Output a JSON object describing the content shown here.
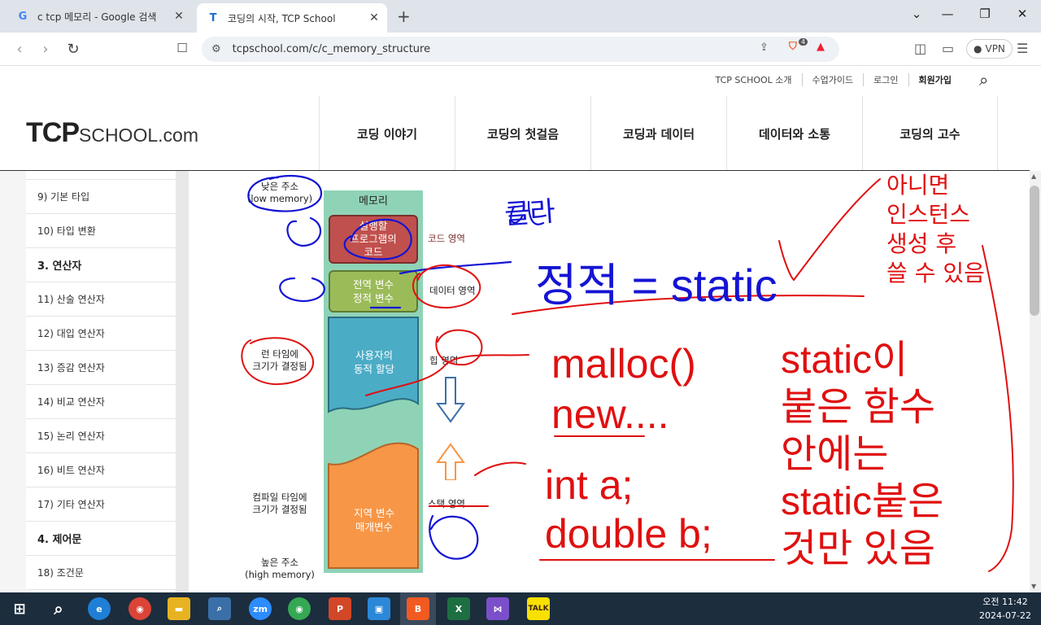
{
  "browser": {
    "tabs": [
      {
        "title": "c tcp 메모리 - Google 검색",
        "icon": "G"
      },
      {
        "title": "코딩의 시작, TCP School",
        "icon": "T"
      }
    ],
    "url": "tcpschool.com/c/c_memory_structure",
    "vpn_label": "VPN",
    "brave_badge": "4"
  },
  "site": {
    "top_menu": [
      "TCP SCHOOL 소개",
      "수업가이드",
      "로그인",
      "회원가입"
    ],
    "logo_main": "TCP",
    "logo_small": "SCHOOL.com",
    "main_nav": [
      "코딩 이야기",
      "코딩의 첫걸음",
      "코딩과 데이터",
      "데이터와 소통",
      "코딩의 고수"
    ]
  },
  "sidebar": {
    "items": [
      {
        "label": "",
        "head": false
      },
      {
        "label": "9) 기본 타입",
        "head": false
      },
      {
        "label": "10) 타입 변환",
        "head": false
      },
      {
        "label": "3. 연산자",
        "head": true
      },
      {
        "label": "11) 산술 연산자",
        "head": false
      },
      {
        "label": "12) 대입 연산자",
        "head": false
      },
      {
        "label": "13) 증감 연산자",
        "head": false
      },
      {
        "label": "14) 비교 연산자",
        "head": false
      },
      {
        "label": "15) 논리 연산자",
        "head": false
      },
      {
        "label": "16) 비트 연산자",
        "head": false
      },
      {
        "label": "17) 기타 연산자",
        "head": false
      },
      {
        "label": "4. 제어문",
        "head": true
      },
      {
        "label": "18) 조건문",
        "head": false
      }
    ]
  },
  "diagram": {
    "memory_title": "메모리",
    "low_addr": [
      "낮은 주소",
      "(low memory)"
    ],
    "high_addr": [
      "높은 주소",
      "(high memory)"
    ],
    "runtime_label": [
      "런 타임에",
      "크기가 결정됨"
    ],
    "compile_label": [
      "컴파일 타임에",
      "크기가 결정됨"
    ],
    "code_block": [
      "실행할",
      "프로그램의",
      "코드"
    ],
    "data_block": [
      "전역 변수",
      "정적 변수"
    ],
    "heap_block": [
      "사용자의",
      "동적 할당"
    ],
    "stack_block": [
      "지역 변수",
      "매개변수"
    ],
    "code_area": "코드 영역",
    "data_area": "데이터 영역",
    "heap_area": "힙 영역",
    "stack_area": "스택 영역",
    "colors": {
      "bg": "#8fd3b6",
      "code": "#c0504d",
      "data": "#9bbb59",
      "heap": "#4bacc6",
      "stack": "#f79646"
    }
  },
  "handwriting": {
    "blue_title": "정적 = static",
    "blue_word": "클라",
    "red_right": [
      "아니면",
      "인스턴스",
      "생성 후",
      "쓸 수 있음"
    ],
    "red_malloc": [
      "malloc()",
      "new...."
    ],
    "red_static_fn": [
      "static이",
      "붙은 함수",
      "안에는",
      "static붙은",
      "것만 있음"
    ],
    "red_stack": [
      "int a;",
      "double b;"
    ]
  },
  "taskbar": {
    "time": "오전 11:42",
    "date": "2024-07-22"
  }
}
